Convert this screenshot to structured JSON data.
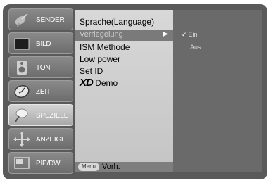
{
  "sidebar": {
    "items": [
      {
        "label": "SENDER",
        "icon": "satellite-dish-icon"
      },
      {
        "label": "BILD",
        "icon": "picture-icon"
      },
      {
        "label": "TON",
        "icon": "speaker-icon"
      },
      {
        "label": "ZEIT",
        "icon": "clock-icon"
      },
      {
        "label": "SPEZIELL",
        "icon": "special-icon"
      },
      {
        "label": "ANZEIGE",
        "icon": "display-icon"
      },
      {
        "label": "PIP/DW",
        "icon": "pip-icon"
      }
    ],
    "active_index": 4
  },
  "menu": {
    "items": [
      {
        "label": "Sprache(Language)"
      },
      {
        "label": "Verriegelung"
      },
      {
        "label": "ISM Methode"
      },
      {
        "label": "Low power"
      },
      {
        "label": "Set ID"
      },
      {
        "label": "Demo",
        "prefix": "XD"
      }
    ],
    "selected_index": 1,
    "footer": {
      "button_label": "Menu",
      "text": "Vorh."
    }
  },
  "options": {
    "items": [
      {
        "label": "Ein",
        "checked": true
      },
      {
        "label": "Aus",
        "checked": false
      }
    ]
  }
}
